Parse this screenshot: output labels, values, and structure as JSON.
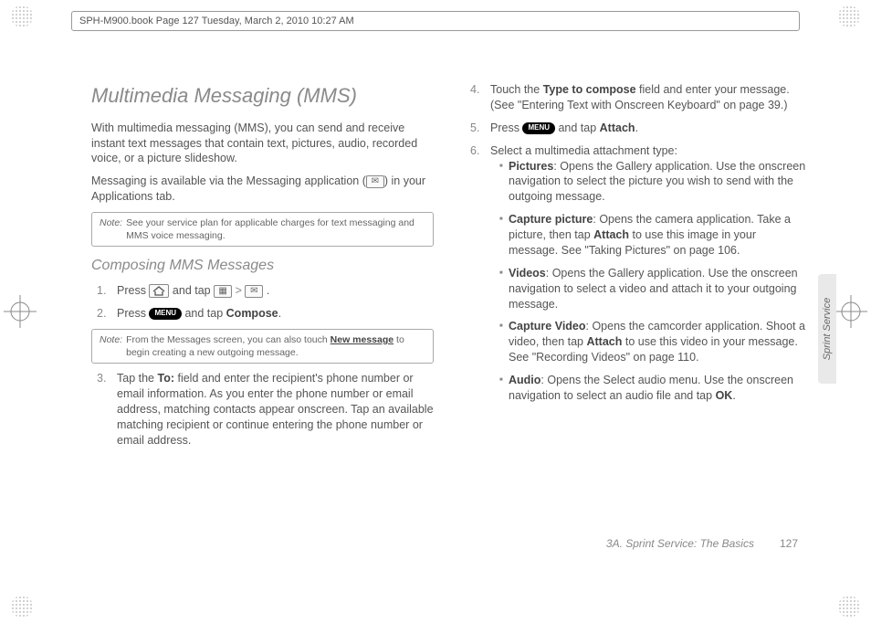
{
  "header": {
    "bookline": "SPH-M900.book  Page 127  Tuesday, March 2, 2010  10:27 AM"
  },
  "side_tab": "Sprint Service",
  "footer": {
    "section": "3A. Sprint Service: The Basics",
    "page": "127"
  },
  "left": {
    "h1": "Multimedia Messaging (MMS)",
    "intro1": "With multimedia messaging (MMS), you can send and receive instant text messages that contain text, pictures, audio, recorded voice, or a picture slideshow.",
    "intro2_a": "Messaging is available via the Messaging application (",
    "intro2_b": ") in your Applications tab.",
    "note1_label": "Note:",
    "note1_text": "See your service plan for applicable charges for text messaging and MMS voice messaging.",
    "h2": "Composing MMS Messages",
    "step1_a": "Press ",
    "step1_b": " and tap ",
    "step1_c": " > ",
    "step1_d": " .",
    "step2_a": "Press ",
    "menu_label": "MENU",
    "step2_b": " and tap ",
    "compose_label": "Compose",
    "step2_c": ".",
    "note2_label": "Note:",
    "note2_a": "From the Messages screen, you can also touch ",
    "note2_b": "New message",
    "note2_c": " to begin creating a new outgoing message.",
    "step3_a": "Tap the ",
    "to_label": "To:",
    "step3_b": " field and enter the recipient's phone number or email information. As you enter the phone number or email address, matching contacts appear onscreen. Tap an available matching recipient or continue entering the phone number or email address."
  },
  "right": {
    "step4_a": "Touch the ",
    "type_label": "Type to compose",
    "step4_b": " field and enter your message. (See \"Entering Text with Onscreen Keyboard\" on page 39.)",
    "step5_a": "Press ",
    "step5_b": " and tap ",
    "attach_label": "Attach",
    "step5_c": ".",
    "step6": "Select a multimedia attachment type:",
    "pic_label": "Pictures",
    "pic_text": ": Opens the Gallery application. Use the onscreen navigation to select the picture you wish to send with the outgoing message.",
    "cappic_label": "Capture picture",
    "cappic_a": ": Opens the camera application. Take a picture, then tap ",
    "cappic_b": " to use this image in your message. See \"Taking Pictures\" on page 106.",
    "vid_label": "Videos",
    "vid_text": ": Opens the Gallery application. Use the onscreen navigation to select a video and attach it to your outgoing message.",
    "capvid_label": "Capture Video",
    "capvid_a": ": Opens the camcorder application. Shoot a video, then tap ",
    "capvid_b": " to use this video in your message. See \"Recording Videos\" on page 110.",
    "audio_label": "Audio",
    "audio_a": ": Opens the Select audio menu. Use the onscreen navigation to select an audio file and tap ",
    "ok_label": "OK",
    "audio_b": "."
  }
}
